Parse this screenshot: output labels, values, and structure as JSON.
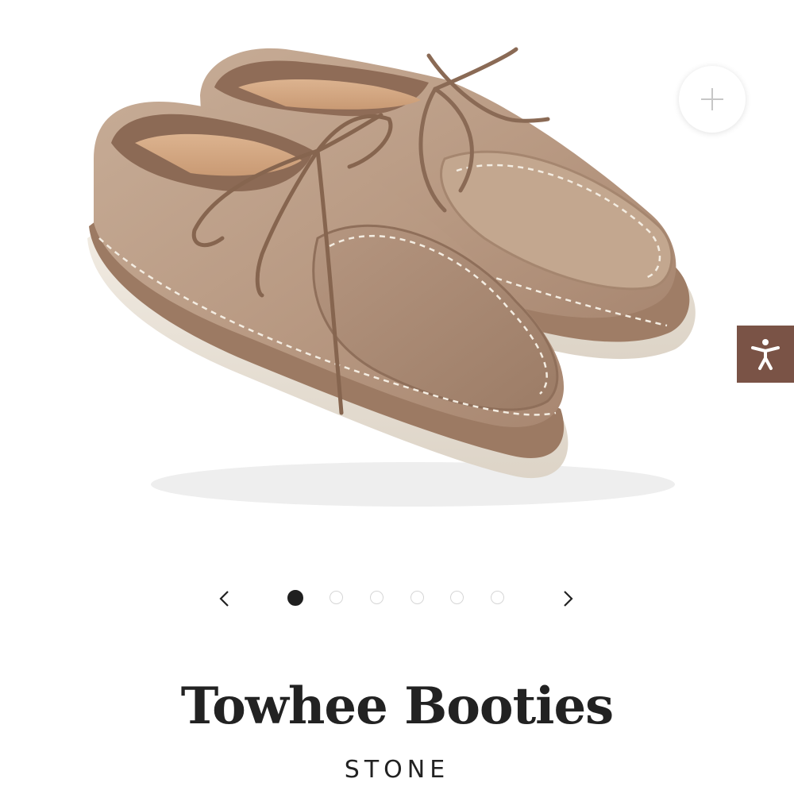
{
  "product": {
    "title": "Towhee Booties",
    "color_variant": "STONE",
    "image_alt": "Towhee Booties in Stone suede"
  },
  "gallery": {
    "slide_count": 6,
    "active_slide": 1
  },
  "icons": {
    "zoom": "plus-icon",
    "accessibility": "accessibility-person-icon",
    "prev": "chevron-left-icon",
    "next": "chevron-right-icon"
  },
  "colors": {
    "accessibility_button": "#7a5346",
    "title_text": "#222222",
    "active_dot": "#1f1f1f",
    "inactive_dot_border": "#d6d6d6"
  }
}
